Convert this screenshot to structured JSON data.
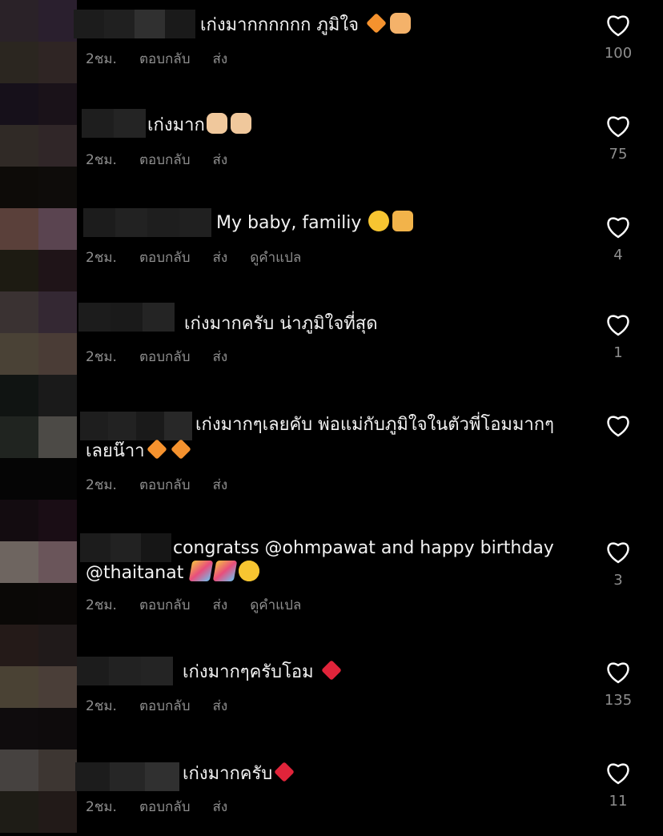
{
  "comments": [
    {
      "text": "เก่งมากกกกกก ภูมิใจ",
      "emojis": [
        "orange-heart",
        "heart-hands"
      ],
      "time": "2ชม.",
      "reply": "ตอบกลับ",
      "send": "ส่ง",
      "translate": "",
      "likes": "100"
    },
    {
      "text": "เก่งมาก",
      "emojis": [
        "clapping-hands",
        "thumbs-up"
      ],
      "time": "2ชม.",
      "reply": "ตอบกลับ",
      "send": "ส่ง",
      "translate": "",
      "likes": "75"
    },
    {
      "text": "My baby, familiy",
      "emojis": [
        "pleading-face",
        "family"
      ],
      "time": "2ชม.",
      "reply": "ตอบกลับ",
      "send": "ส่ง",
      "translate": "ดูคำแปล",
      "likes": "4"
    },
    {
      "text": "เก่งมากครับ น่าภูมิใจที่สุด",
      "emojis": [],
      "time": "2ชม.",
      "reply": "ตอบกลับ",
      "send": "ส่ง",
      "translate": "",
      "likes": "1"
    },
    {
      "text": "เก่งมากๆเลยคับ พ่อแม่กับภูมิใจในตัวพี่โอมมากๆ",
      "text2": "เลยน๊าา",
      "emojis": [
        "orange-heart",
        "orange-heart"
      ],
      "time": "2ชม.",
      "reply": "ตอบกลับ",
      "send": "ส่ง",
      "translate": "",
      "likes": ""
    },
    {
      "text": "congratss @ohmpawat  and happy birthday",
      "text2": "@thaitanat",
      "emojis": [
        "party-popper",
        "party-popper",
        "heart-eyes"
      ],
      "time": "2ชม.",
      "reply": "ตอบกลับ",
      "send": "ส่ง",
      "translate": "ดูคำแปล",
      "likes": "3"
    },
    {
      "text": "เก่งมากๆครับโอม",
      "emojis": [
        "red-heart"
      ],
      "time": "2ชม.",
      "reply": "ตอบกลับ",
      "send": "ส่ง",
      "translate": "",
      "likes": "135"
    },
    {
      "text": "เก่งมากครับ",
      "emojis": [
        "red-heart"
      ],
      "time": "2ชม.",
      "reply": "ตอบกลับ",
      "send": "ส่ง",
      "translate": "",
      "likes": "11"
    }
  ],
  "colors": {
    "background": "#000000",
    "text": "#f2f2f2",
    "muted": "#8e8e8e"
  }
}
